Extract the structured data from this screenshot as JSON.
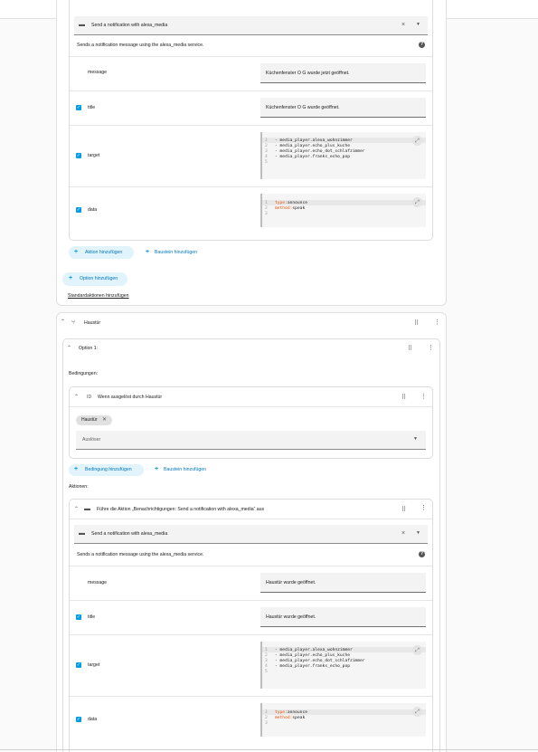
{
  "top_action": {
    "service_select": "Send a notification with alexa_media",
    "description": "Sends a notification message using the alexa_media service.",
    "fields": {
      "message": {
        "label": "message",
        "value": "Küchenfenster O G wurde jetzt geöffnet."
      },
      "title": {
        "label": "title",
        "value": "Küchenfenster O G wurde geöffnet."
      },
      "target": {
        "label": "target",
        "lines": [
          "- media_player.alexa_wohnzimmer",
          "- media_player.echo_plus_kuche",
          "- media_player.echo_dot_schlafzimmer",
          "- media_player.franks_echo_pop",
          ""
        ],
        "line_numbers": [
          "1",
          "2",
          "3",
          "4",
          "5"
        ]
      },
      "data": {
        "label": "data",
        "line1_key": "type:",
        "line1_val": " announce",
        "line2_key": "method:",
        "line2_val": " speak",
        "line_numbers": [
          "1",
          "2",
          "3"
        ]
      }
    }
  },
  "buttons": {
    "add_action": "Aktion hinzufügen",
    "add_block": "Baustein hinzufügen",
    "add_option": "Option hinzufügen",
    "add_default_actions": "Standardaktionen hinzufügen",
    "add_condition": "Bedingung hinzufügen",
    "add_block_2": "Baustein hinzufügen"
  },
  "section": {
    "title": "Haustür",
    "option_title": "Option 1:",
    "conditions_label": "Bedingungen:",
    "condition_title": "Wenn ausgelöst durch Haustür",
    "chip_label": "Haustür",
    "trigger_select": "Auslöser",
    "actions_label": "Aktionen:",
    "action_title": "Führe die Aktion „Benachrichtigungen: Send a notification with alexa_media“ aus"
  },
  "bottom_action": {
    "service_select": "Send a notification with alexa_media",
    "description": "Sends a notification message using the alexa_media service.",
    "fields": {
      "message": {
        "label": "message",
        "value": "Haustür wurde geöffnet."
      },
      "title": {
        "label": "title",
        "value": "Haustür wurde geöffnet."
      },
      "target": {
        "label": "target",
        "lines": [
          "- media_player.alexa_wohnzimmer",
          "- media_player.echo_plus_kuche",
          "- media_player.echo_dot_schlafzimmer",
          "- media_player.franks_echo_pop",
          ""
        ],
        "line_numbers": [
          "1",
          "2",
          "3",
          "4",
          "5"
        ]
      },
      "data": {
        "label": "data",
        "line1_key": "type:",
        "line1_val": " announce",
        "line2_key": "method:",
        "line2_val": " speak",
        "line_numbers": [
          "1",
          "2",
          "3"
        ]
      }
    }
  },
  "icons": {
    "comment": "comment-icon",
    "close": "close-icon",
    "dropdown": "chevron-down-icon",
    "help": "help-icon",
    "expand": "expand-icon",
    "plus": "plus-icon",
    "drag": "drag-handle-icon",
    "more": "more-vertical-icon",
    "collapse": "chevron-up-icon",
    "choose": "choose-icon",
    "id": "id-icon"
  },
  "colors": {
    "accent": "#039be5",
    "pill_bg": "#e1f3fb",
    "yaml_key": "#e65100"
  }
}
